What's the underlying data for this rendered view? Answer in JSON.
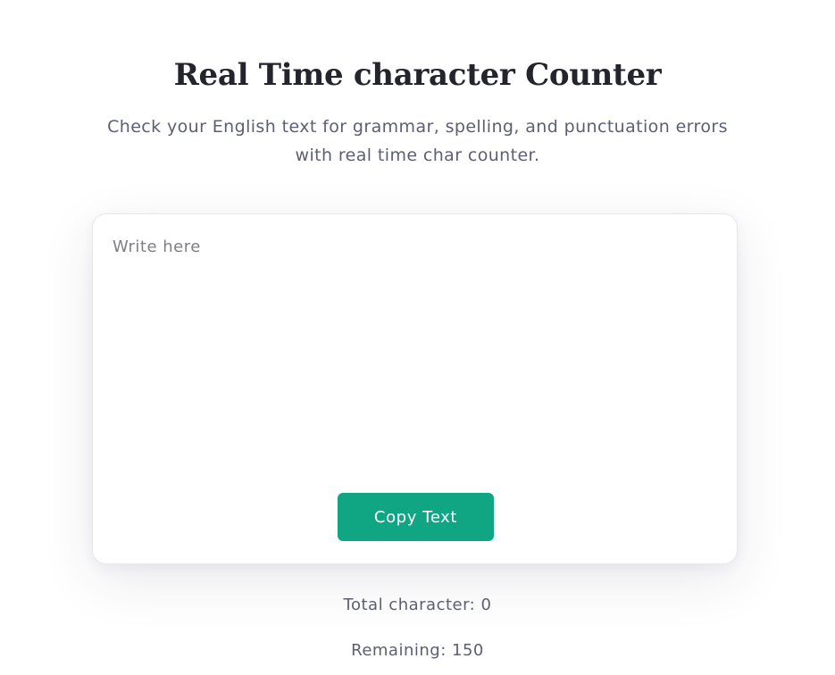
{
  "header": {
    "title": "Real Time character Counter",
    "subtitle": "Check your English text for grammar, spelling, and punctuation errors with real time char counter."
  },
  "editor": {
    "placeholder": "Write here",
    "value": ""
  },
  "actions": {
    "copy_label": "Copy Text"
  },
  "stats": {
    "total_label": "Total character:",
    "total_value": 0,
    "remaining_label": "Remaining:",
    "remaining_value": 150
  },
  "colors": {
    "accent": "#11a683",
    "title": "#24242d",
    "muted_text": "#5c5f72"
  }
}
